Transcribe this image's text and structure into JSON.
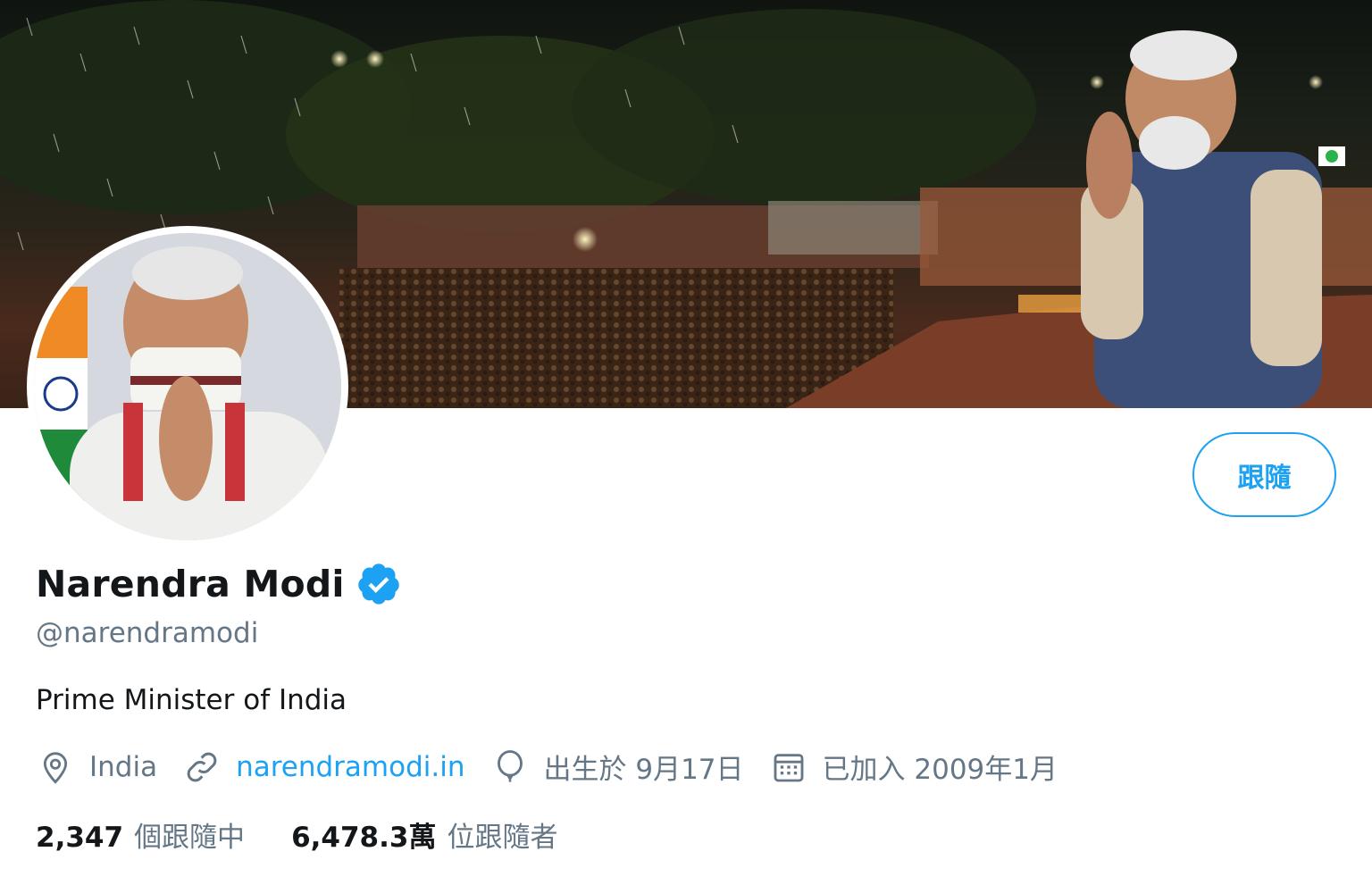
{
  "profile": {
    "name": "Narendra Modi",
    "handle": "@narendramodi",
    "bio": "Prime Minister of India",
    "follow_label": "跟隨",
    "location": "India",
    "website": "narendramodi.in",
    "birthday": "出生於 9月17日",
    "joined": "已加入 2009年1月"
  },
  "stats": {
    "following_count": "2,347",
    "following_label": "個跟隨中",
    "followers_count": "6,478.3萬",
    "followers_label": "位跟隨者"
  },
  "icons": {
    "verified": "verified-badge-icon",
    "location": "location-pin-icon",
    "link": "link-icon",
    "birthday": "balloon-icon",
    "joined": "calendar-icon"
  },
  "colors": {
    "accent": "#1da1f2",
    "text": "#14171a",
    "muted": "#657786"
  }
}
